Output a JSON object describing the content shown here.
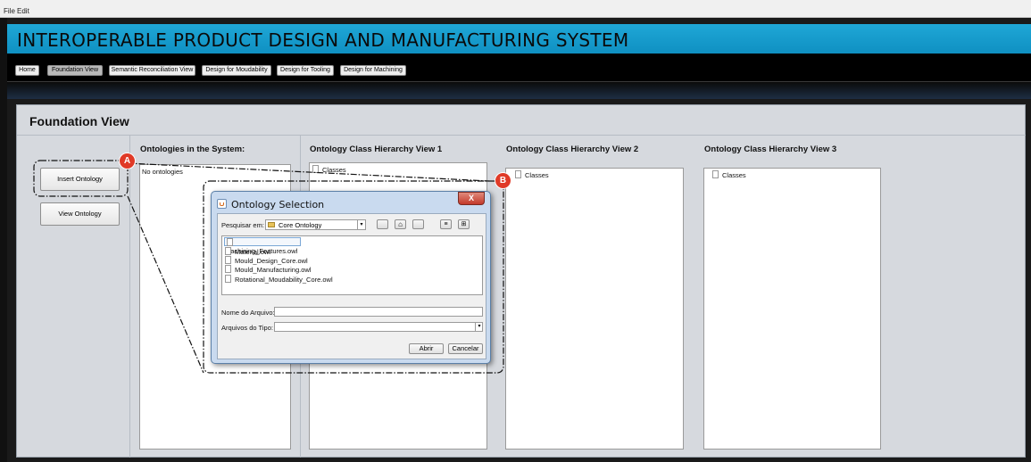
{
  "menu": {
    "file": "File",
    "edit": "Edit"
  },
  "app_title": "INTEROPERABLE PRODUCT DESIGN AND MANUFACTURING SYSTEM",
  "nav": [
    "Home",
    "Foundation View",
    "Semantic Reconciliation View",
    "Design for Moudability",
    "Design for Tooling",
    "Design for Machining"
  ],
  "panel": {
    "title": "Foundation View",
    "buttons": {
      "insert": "Insert Ontology",
      "view": "View Ontology"
    },
    "columns": {
      "ontologies": {
        "heading": "Ontologies in the System:",
        "empty": "No ontologies"
      },
      "hierarchy1": {
        "heading": "Ontology Class Hierarchy View 1",
        "root": "Classes"
      },
      "hierarchy2": {
        "heading": "Ontology Class Hierarchy View 2",
        "root": "Classes"
      },
      "hierarchy3": {
        "heading": "Ontology Class Hierarchy View 3",
        "root": "Classes"
      }
    }
  },
  "callouts": {
    "a": "A",
    "b": "B"
  },
  "dialog": {
    "title": "Ontology Selection",
    "look_in_label": "Pesquisar em:",
    "look_in_value": "Core Ontology",
    "files": [
      "Machining_Features.owl",
      "Material.owl",
      "Mould_Design_Core.owl",
      "Mould_Manufacturing.owl",
      "Rotational_Moudability_Core.owl"
    ],
    "filename_label": "Nome do Arquivo:",
    "filename_value": "",
    "filetype_label": "Arquivos do Tipo:",
    "filetype_value": "",
    "open_button": "Abrir",
    "cancel_button": "Cancelar",
    "close_glyph": "X"
  },
  "colors": {
    "title_bar": "#1aa0d0",
    "callout": "#e03a27",
    "panel_bg": "#d6d9de"
  }
}
